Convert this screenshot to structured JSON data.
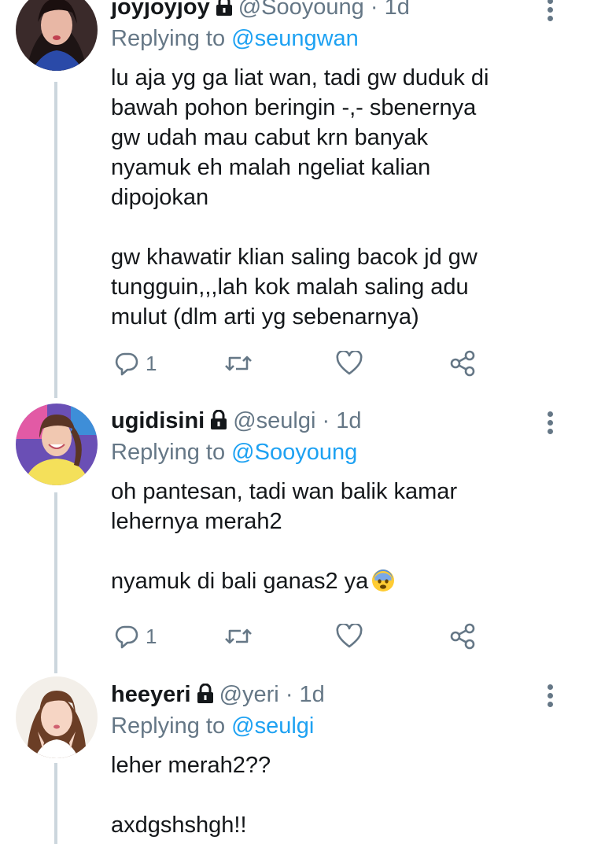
{
  "tweets": [
    {
      "display_name": "joyjoyjoy",
      "handle": "@Sooyoung",
      "time": "1d",
      "replying_prefix": "Replying to",
      "replying_to": "@seungwan",
      "paragraphs": [
        [
          "lu aja yg ga liat wan, tadi gw duduk di",
          "bawah pohon beringin -,- sbenernya",
          "gw udah mau cabut krn banyak",
          "nyamuk eh malah ngeliat kalian",
          "dipojokan"
        ],
        [
          "gw khawatir klian saling bacok jd gw",
          "tungguin,,,lah kok malah saling adu",
          "mulut (dlm arti yg sebenarnya)"
        ]
      ],
      "reply_count": "1"
    },
    {
      "display_name": "ugidisini",
      "handle": "@seulgi",
      "time": "1d",
      "replying_prefix": "Replying to",
      "replying_to": "@Sooyoung",
      "paragraphs": [
        [
          "oh pantesan, tadi wan balik kamar",
          "lehernya merah2"
        ],
        [
          "nyamuk di bali ganas2 ya"
        ]
      ],
      "reply_count": "1"
    },
    {
      "display_name": "heeyeri",
      "handle": "@yeri",
      "time": "1d",
      "replying_prefix": "Replying to",
      "replying_to": "@seulgi",
      "paragraphs": [
        [
          "leher merah2??"
        ],
        [
          "axdgshshgh!!"
        ]
      ]
    }
  ],
  "separator": "·",
  "icons": {
    "reply": "reply-icon",
    "retweet": "retweet-icon",
    "like": "heart-icon",
    "share": "share-icon",
    "more": "more-options-icon",
    "lock": "lock-icon",
    "emoji": "fearful-face-emoji"
  },
  "colors": {
    "link": "#1da1f2",
    "secondary": "#657786",
    "text": "#14171a",
    "thread_line": "#ccd6dd"
  }
}
